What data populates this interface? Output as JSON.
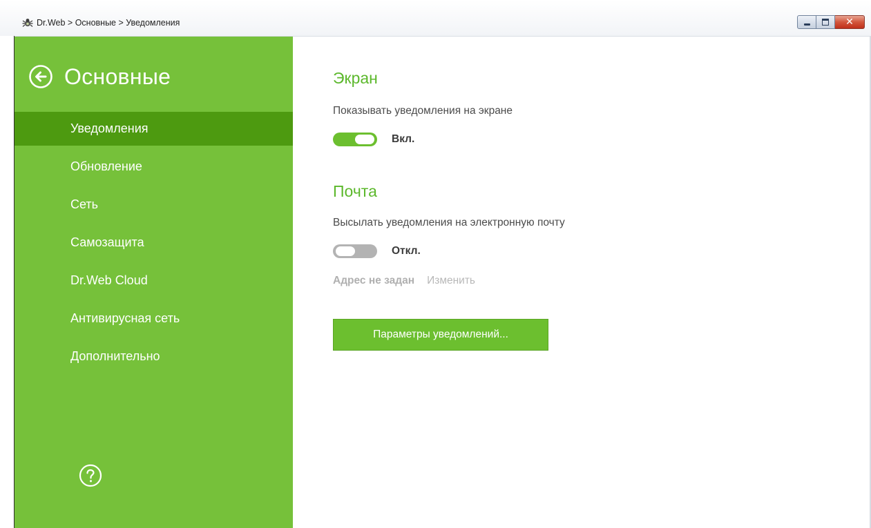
{
  "window": {
    "title": "Dr.Web > Основные > Уведомления",
    "icon": "spider-icon",
    "controls": [
      "minimize-icon",
      "maximize-icon",
      "close-icon"
    ],
    "close_glyph": "✕"
  },
  "sidebar": {
    "title": "Основные",
    "back_icon": "back-arrow-icon",
    "help_icon": "help-icon",
    "items": [
      {
        "label": "Уведомления",
        "active": true
      },
      {
        "label": "Обновление",
        "active": false
      },
      {
        "label": "Сеть",
        "active": false
      },
      {
        "label": "Самозащита",
        "active": false
      },
      {
        "label": "Dr.Web Cloud",
        "active": false
      },
      {
        "label": "Антивирусная сеть",
        "active": false
      },
      {
        "label": "Дополнительно",
        "active": false
      }
    ]
  },
  "screen_section": {
    "title": "Экран",
    "description": "Показывать уведомления на экране",
    "toggle_on": true,
    "toggle_label": "Вкл."
  },
  "mail_section": {
    "title": "Почта",
    "description": "Высылать уведомления на электронную почту",
    "toggle_on": false,
    "toggle_label": "Откл.",
    "address_status": "Адрес не задан",
    "change_link": "Изменить"
  },
  "params_button": "Параметры уведомлений...",
  "colors": {
    "sidebar_bg": "#76c13a",
    "sidebar_active": "#4d9a10",
    "accent": "#5cb82c",
    "toggle_on": "#6cbf2f",
    "toggle_off": "#b3b3b3"
  }
}
